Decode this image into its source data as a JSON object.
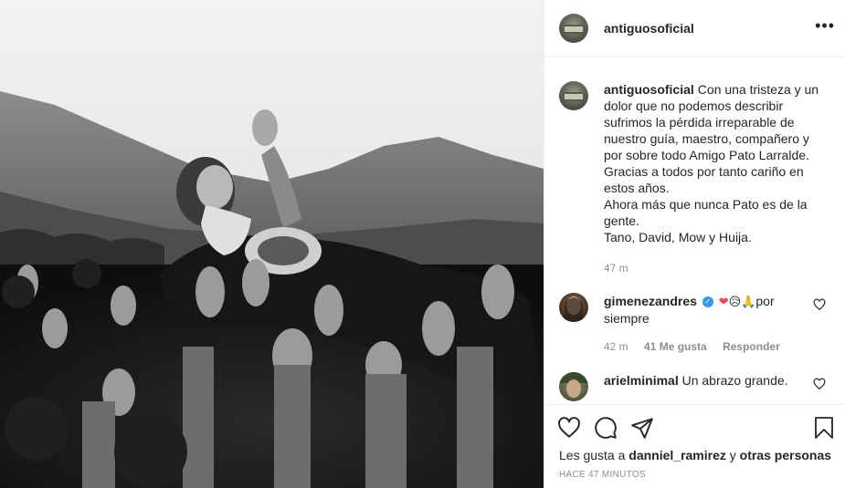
{
  "post": {
    "username": "antiguosoficial",
    "more_label": "•••",
    "caption": {
      "username": "antiguosoficial",
      "lines": [
        "Con una tristeza y un",
        "dolor que no podemos describir",
        "sufrimos la pérdida irreparable de",
        "nuestro guía, maestro, compañero y",
        "por sobre todo Amigo Pato Larralde.",
        "Gracias a todos por tanto cariño en",
        "estos años.",
        "Ahora más que nunca Pato es de la",
        "gente.",
        "Tano, David, Mow y Huija."
      ],
      "time": "47 m"
    },
    "comments": [
      {
        "username": "gimenezandres",
        "text_line1": "por",
        "text_line2": "siempre",
        "emojis": [
          "❤",
          "😥",
          "🙏"
        ],
        "time": "42 m",
        "likes": "41 Me gusta",
        "reply": "Responder"
      },
      {
        "username": "arielminimal",
        "text": "Un abrazo grande."
      }
    ],
    "likes": {
      "prefix": "Les gusta a",
      "user": "danniel_ramirez",
      "connector": "y",
      "others": "otras personas"
    },
    "timestamp": "HACE 47 MINUTOS"
  },
  "icons": {
    "like": "heart-icon",
    "comment": "comment-icon",
    "share": "share-icon",
    "save": "bookmark-icon",
    "verified": "verified-badge-icon"
  },
  "colors": {
    "text": "#262626",
    "muted": "#8e8e8e",
    "heart": "#ed4956",
    "verified": "#3897f0",
    "divider": "#efefef"
  }
}
